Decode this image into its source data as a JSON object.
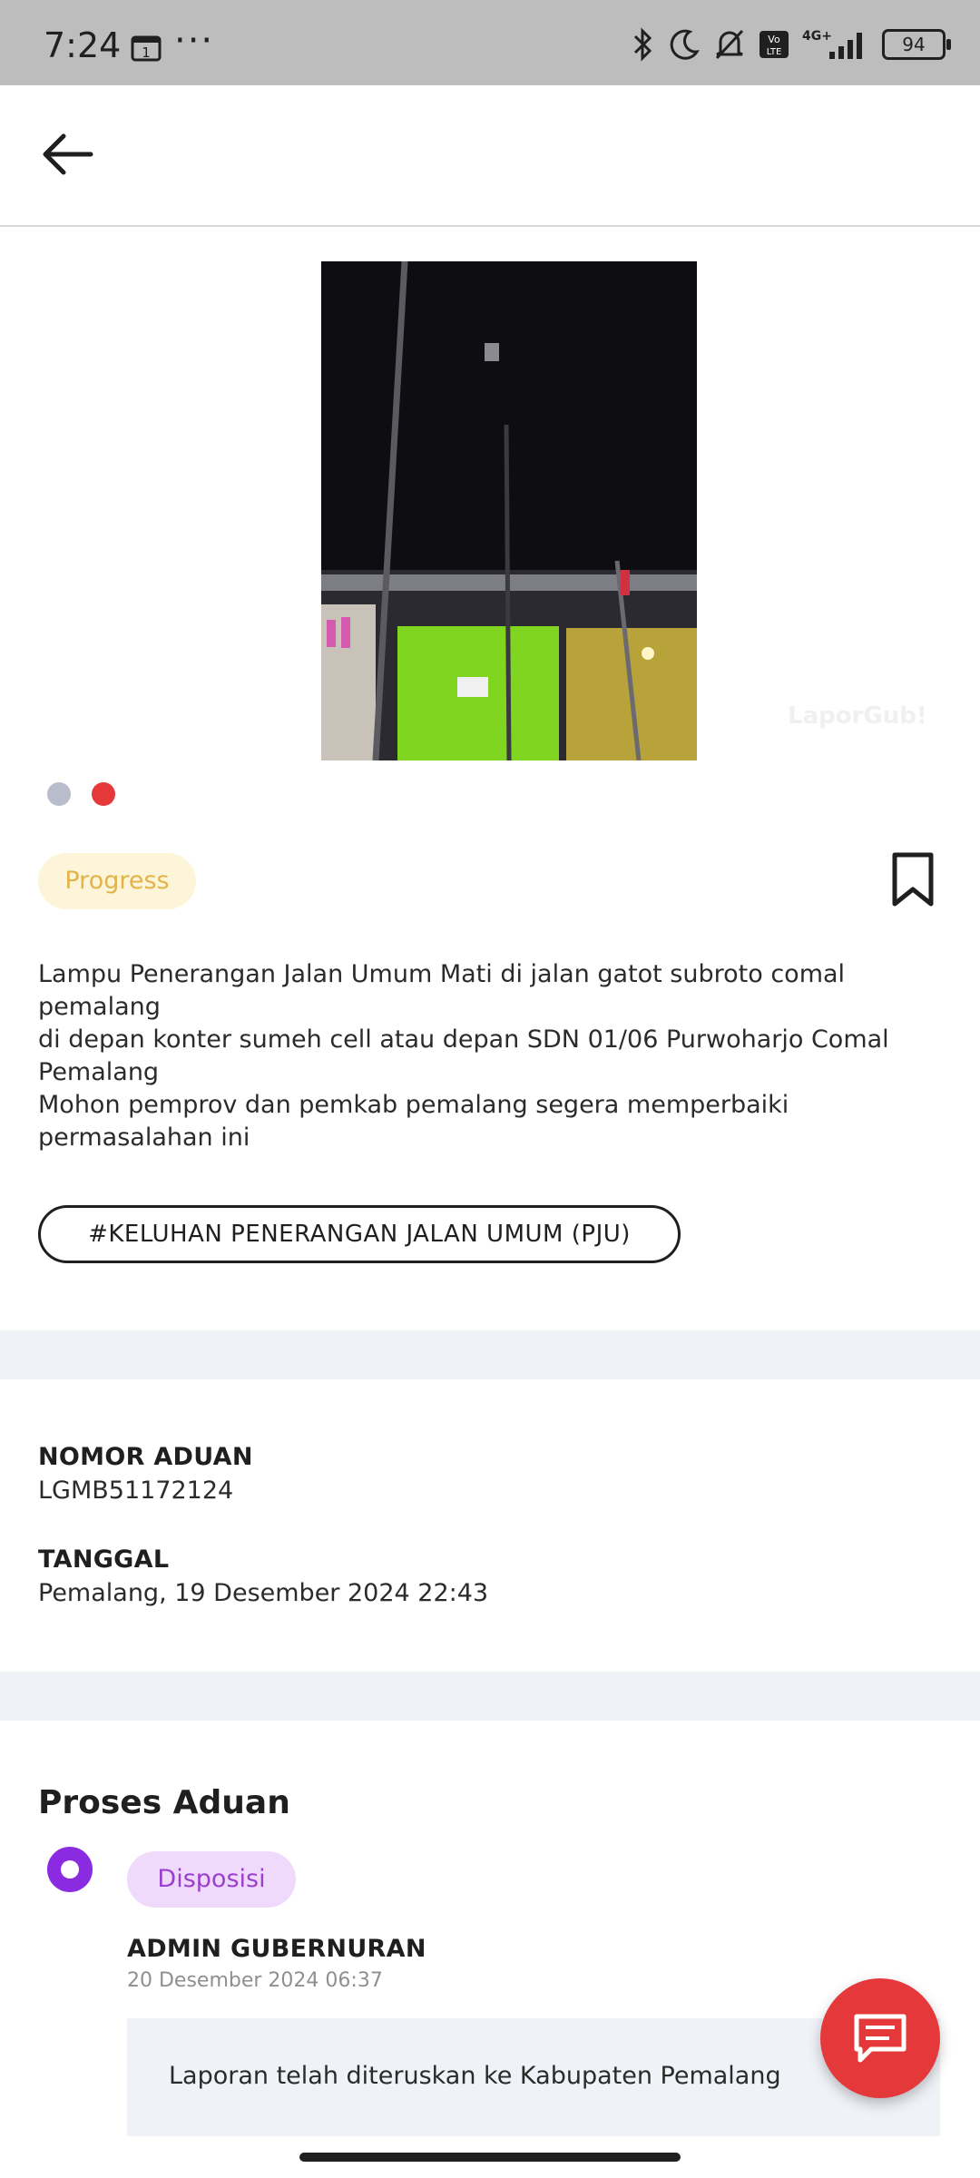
{
  "status_bar": {
    "time": "7:24",
    "dots": "···",
    "battery": "94",
    "icons": [
      "calendar-icon",
      "bluetooth-icon",
      "moon-icon",
      "bell-off-icon",
      "volte-icon",
      "signal-4g-icon",
      "battery-icon"
    ]
  },
  "app_bar": {
    "back_icon": "arrow-left-icon"
  },
  "gallery": {
    "watermark": "LaporGub!",
    "dots": 2,
    "active_dot": 2,
    "colors": {
      "inactive": "#b9bccb",
      "active": "#e5383b"
    }
  },
  "report": {
    "status": "Progress",
    "bookmark_icon": "bookmark-icon",
    "description": "Lampu Penerangan Jalan Umum Mati di jalan gatot subroto comal pemalang\ndi depan konter sumeh cell atau depan SDN 01/06 Purwoharjo Comal Pemalang\nMohon pemprov dan pemkab pemalang segera memperbaiki permasalahan ini",
    "tag": "#KELUHAN PENERANGAN JALAN UMUM (PJU)"
  },
  "info": {
    "nomor_label": "NOMOR ADUAN",
    "nomor_value": "LGMB51172124",
    "tanggal_label": "TANGGAL",
    "tanggal_value": "Pemalang, 19 Desember 2024 22:43"
  },
  "proses": {
    "title": "Proses Aduan",
    "steps": [
      {
        "badge": "Disposisi",
        "author": "ADMIN GUBERNURAN",
        "time": "20 Desember 2024 06:37",
        "note": "Laporan telah diteruskan ke Kabupaten Pemalang"
      }
    ]
  },
  "fab": {
    "icon": "chat-icon"
  },
  "colors": {
    "accent_red": "#e5383b",
    "progress_bg": "#fdf5d9",
    "progress_text": "#e3b34a",
    "disposisi_bg": "#efdafb",
    "disposisi_text": "#9b3fd1",
    "timeline_purple": "#8a2be2",
    "band_gray": "#eff2f7"
  }
}
